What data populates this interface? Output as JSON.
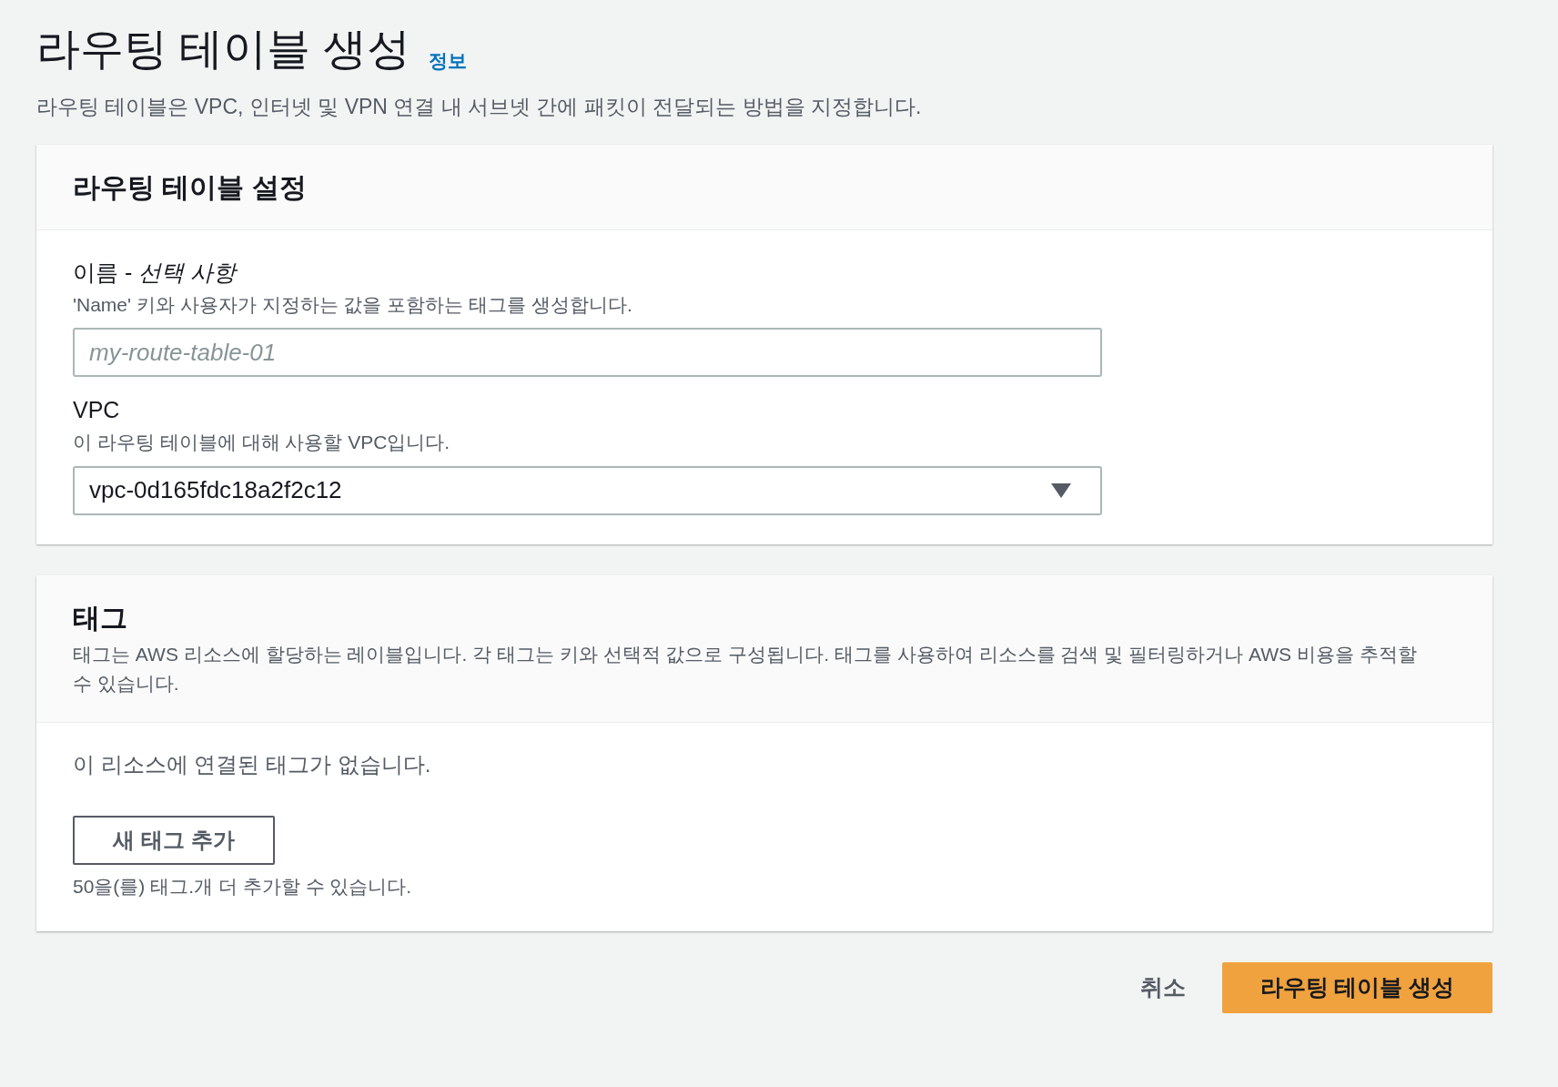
{
  "page": {
    "title": "라우팅 테이블 생성",
    "info_link": "정보",
    "description": "라우팅 테이블은 VPC, 인터넷 및 VPN 연결 내 서브넷 간에 패킷이 전달되는 방법을 지정합니다."
  },
  "settings": {
    "title": "라우팅 테이블 설정",
    "name_field": {
      "label": "이름 - ",
      "label_optional": "선택 사항",
      "hint": "'Name' 키와 사용자가 지정하는 값을 포함하는 태그를 생성합니다.",
      "placeholder": "my-route-table-01"
    },
    "vpc_field": {
      "label": "VPC",
      "hint": "이 라우팅 테이블에 대해 사용할 VPC입니다.",
      "value": "vpc-0d165fdc18a2f2c12"
    }
  },
  "tags": {
    "title": "태그",
    "description": "태그는 AWS 리소스에 할당하는 레이블입니다. 각 태그는 키와 선택적 값으로 구성됩니다. 태그를 사용하여 리소스를 검색 및 필터링하거나 AWS 비용을 추적할 수 있습니다.",
    "empty_message": "이 리소스에 연결된 태그가 없습니다.",
    "add_button": "새 태그 추가",
    "limit_note": "50을(를) 태그.개 더 추가할 수 있습니다."
  },
  "footer": {
    "cancel": "취소",
    "submit": "라우팅 테이블 생성"
  }
}
